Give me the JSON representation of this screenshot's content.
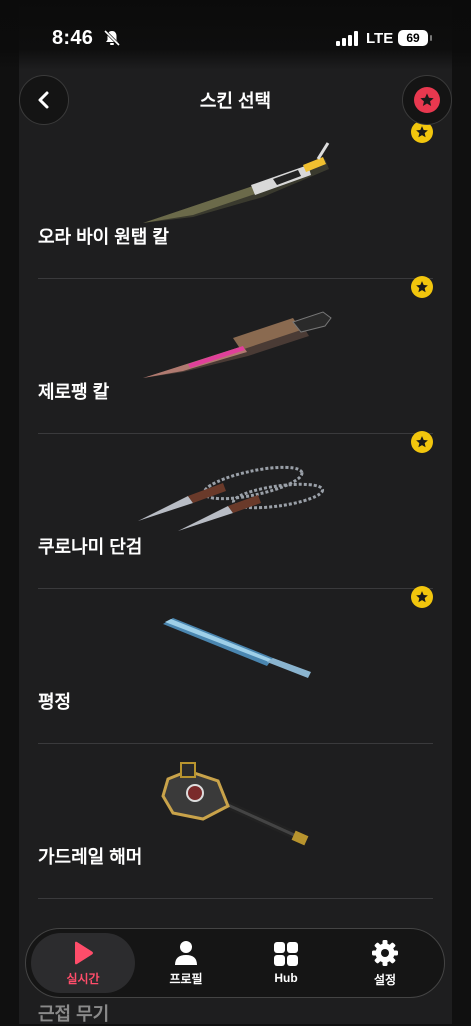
{
  "status_bar": {
    "time": "8:46",
    "network": "LTE",
    "battery": "69"
  },
  "header": {
    "title": "스킨 선택"
  },
  "items": [
    {
      "name": "오라 바이 원탭 칼",
      "favorite": true
    },
    {
      "name": "제로팽 칼",
      "favorite": true
    },
    {
      "name": "쿠로나미 단검",
      "favorite": true
    },
    {
      "name": "평정",
      "favorite": true
    },
    {
      "name": "가드레일 해머",
      "favorite": false
    }
  ],
  "partial_item": {
    "name": "근접 무기"
  },
  "tabbar": {
    "tabs": [
      {
        "label": "실시간",
        "icon": "play-icon",
        "active": true
      },
      {
        "label": "프로필",
        "icon": "person-icon",
        "active": false
      },
      {
        "label": "Hub",
        "icon": "grid-icon",
        "active": false
      },
      {
        "label": "설정",
        "icon": "gear-icon",
        "active": false
      }
    ]
  },
  "colors": {
    "accent": "#ff4d6a",
    "favorite_star": "#f2c60d",
    "header_star": "#e8384f"
  }
}
